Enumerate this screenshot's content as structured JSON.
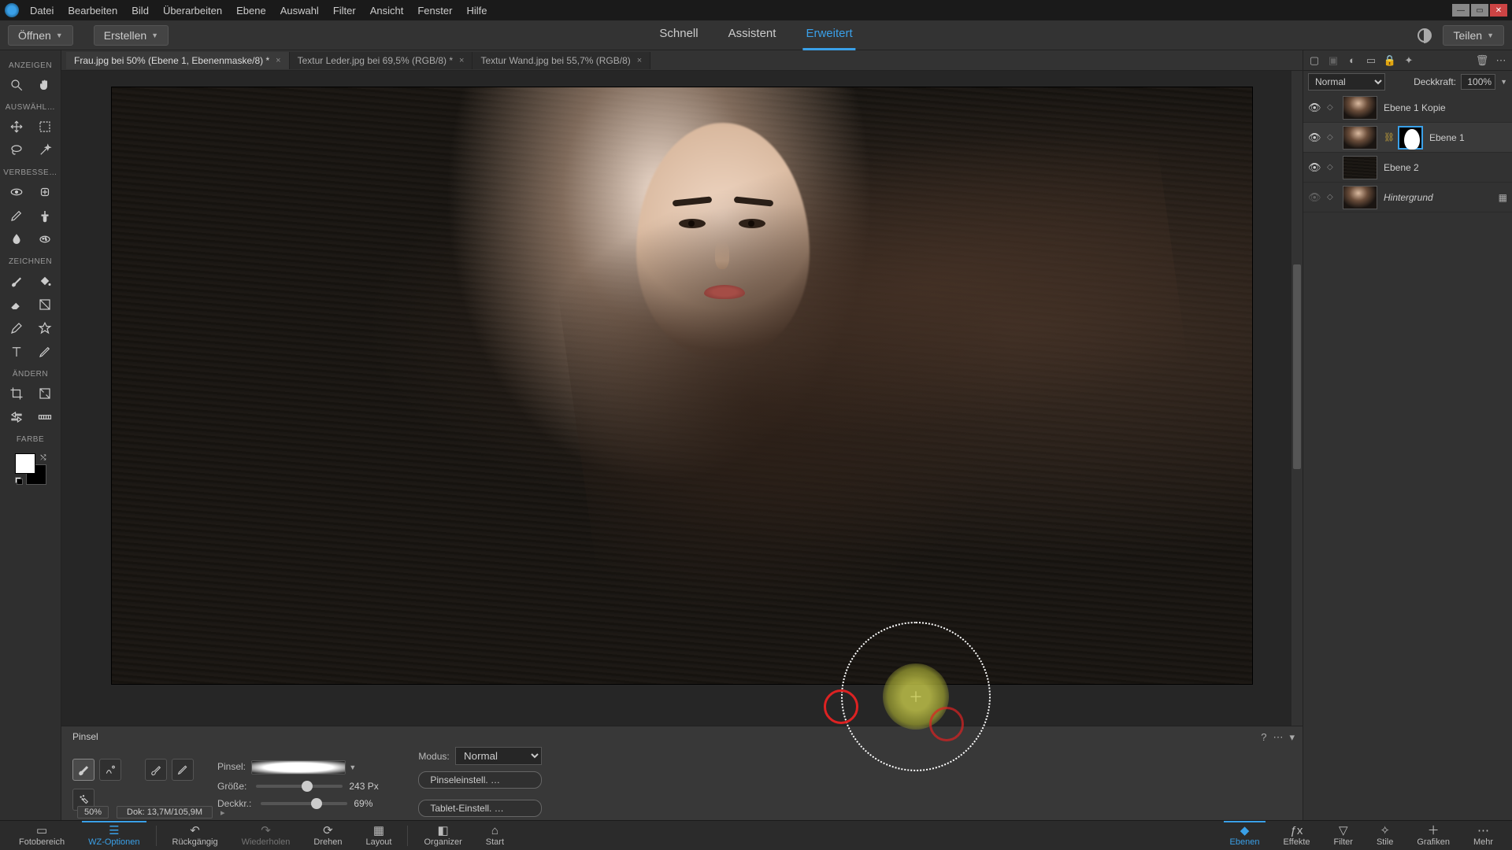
{
  "menubar": [
    "Datei",
    "Bearbeiten",
    "Bild",
    "Überarbeiten",
    "Ebene",
    "Auswahl",
    "Filter",
    "Ansicht",
    "Fenster",
    "Hilfe"
  ],
  "header": {
    "open": "Öffnen",
    "create": "Erstellen",
    "modes": {
      "quick": "Schnell",
      "guided": "Assistent",
      "expert": "Erweitert"
    },
    "share": "Teilen"
  },
  "doctabs": [
    {
      "label": "Frau.jpg bei 50% (Ebene 1, Ebenenmaske/8) *",
      "active": true
    },
    {
      "label": "Textur Leder.jpg bei 69,5% (RGB/8) *",
      "active": false
    },
    {
      "label": "Textur Wand.jpg bei 55,7% (RGB/8)",
      "active": false
    }
  ],
  "lefttools": {
    "sections": {
      "view": "ANZEIGEN",
      "select": "AUSWÄHL…",
      "enhance": "VERBESSE…",
      "draw": "ZEICHNEN",
      "modify": "ÄNDERN",
      "color": "FARBE"
    }
  },
  "status": {
    "zoom": "50%",
    "doc": "Dok: 13,7M/105,9M"
  },
  "options": {
    "title": "Pinsel",
    "brush_label": "Pinsel:",
    "size_label": "Größe:",
    "size_value": "243 Px",
    "size_pct": 0.52,
    "opacity_label": "Deckkr.:",
    "opacity_value": "69%",
    "opacity_pct": 0.58,
    "mode_label": "Modus:",
    "mode_value": "Normal",
    "brush_settings": "Pinseleinstell. …",
    "tablet_settings": "Tablet-Einstell. …"
  },
  "layerspanel": {
    "blend_label": "",
    "blend_value": "Normal",
    "opacity_label": "Deckkraft:",
    "opacity_value": "100%",
    "layers": [
      {
        "name": "Ebene 1 Kopie",
        "visible": true,
        "type": "portrait"
      },
      {
        "name": "Ebene 1",
        "visible": true,
        "type": "portrait",
        "selected": true,
        "mask": true,
        "linked": true
      },
      {
        "name": "Ebene 2",
        "visible": true,
        "type": "texture"
      },
      {
        "name": "Hintergrund",
        "visible": false,
        "type": "portrait",
        "italic": true,
        "locked": true
      }
    ]
  },
  "footer": {
    "left": [
      {
        "id": "photobin",
        "label": "Fotobereich"
      },
      {
        "id": "toolopts",
        "label": "WZ-Optionen",
        "active": true
      }
    ],
    "mid": [
      {
        "id": "undo",
        "label": "Rückgängig"
      },
      {
        "id": "redo",
        "label": "Wiederholen"
      },
      {
        "id": "rotate",
        "label": "Drehen"
      },
      {
        "id": "layout",
        "label": "Layout"
      }
    ],
    "mid2": [
      {
        "id": "organizer",
        "label": "Organizer"
      },
      {
        "id": "home",
        "label": "Start"
      }
    ],
    "right": [
      {
        "id": "layers",
        "label": "Ebenen",
        "active": true
      },
      {
        "id": "effects",
        "label": "Effekte"
      },
      {
        "id": "filters",
        "label": "Filter"
      },
      {
        "id": "styles",
        "label": "Stile"
      },
      {
        "id": "graphics",
        "label": "Grafiken"
      },
      {
        "id": "more",
        "label": "Mehr"
      }
    ]
  }
}
